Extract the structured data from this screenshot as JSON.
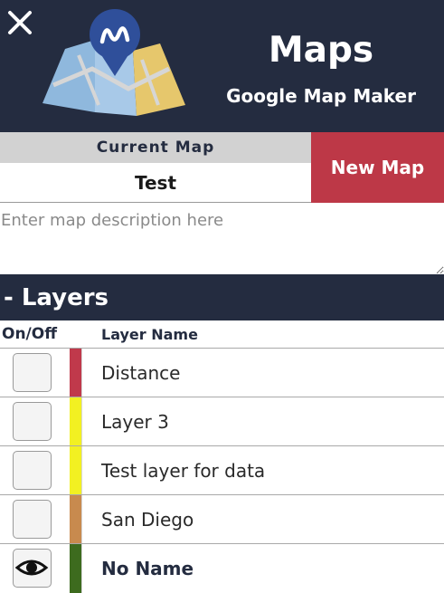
{
  "header": {
    "title": "Maps",
    "subtitle": "Google Map Maker",
    "close_icon": "close-icon",
    "logo_icon": "folded-map-pin-logo"
  },
  "current_map": {
    "label": "Current Map",
    "name": "Test",
    "new_map_label": "New Map",
    "description_placeholder": "Enter map description here",
    "description_value": ""
  },
  "layers": {
    "heading": "- Layers",
    "col_onoff": "On/Off",
    "col_name": "Layer Name",
    "items": [
      {
        "name": "Distance",
        "color": "#c0394b",
        "visible": false
      },
      {
        "name": "Layer 3",
        "color": "#f2f022",
        "visible": false
      },
      {
        "name": "Test layer for data",
        "color": "#f2f022",
        "visible": false
      },
      {
        "name": "San Diego",
        "color": "#c88a4e",
        "visible": false
      },
      {
        "name": "No Name",
        "color": "#3d6b1e",
        "visible": true
      }
    ]
  },
  "colors": {
    "header_bg": "#242c40",
    "accent_red": "#bd3847",
    "label_bg": "#d2d2d2"
  }
}
